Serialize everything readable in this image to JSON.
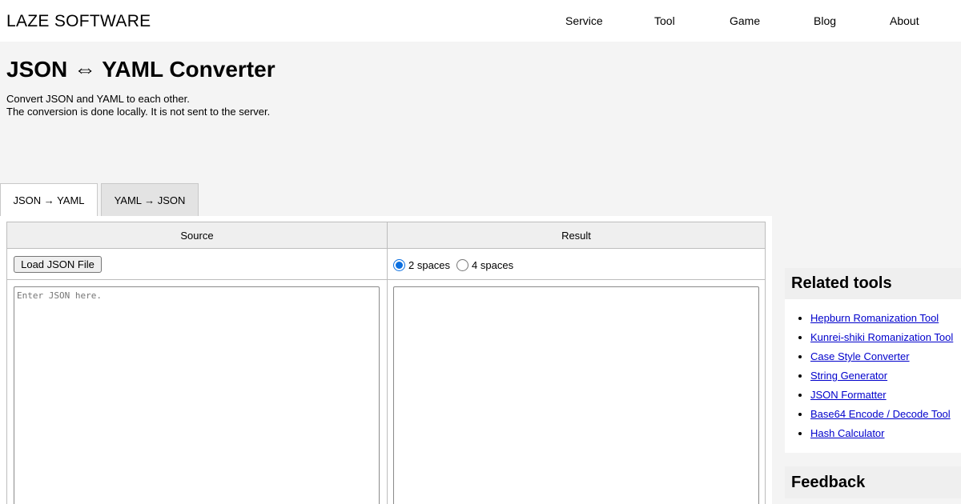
{
  "header": {
    "logo": "LAZE SOFTWARE",
    "nav": [
      "Service",
      "Tool",
      "Game",
      "Blog",
      "About"
    ]
  },
  "page": {
    "title": "JSON ⇔ YAML Converter",
    "description_line1": "Convert JSON and YAML to each other.",
    "description_line2": "The conversion is done locally. It is not sent to the server."
  },
  "tabs": [
    {
      "label": "JSON → YAML",
      "active": true
    },
    {
      "label": "YAML → JSON",
      "active": false
    }
  ],
  "converter": {
    "source_header": "Source",
    "result_header": "Result",
    "load_button": "Load JSON File",
    "indent_options": [
      {
        "label": "2 spaces",
        "checked": true
      },
      {
        "label": "4 spaces",
        "checked": false
      }
    ],
    "source_placeholder": "Enter JSON here.",
    "source_value": "",
    "result_value": ""
  },
  "sidebar": {
    "related_title": "Related tools",
    "related_tools": [
      "Hepburn Romanization Tool",
      "Kunrei-shiki Romanization Tool",
      "Case Style Converter",
      "String Generator",
      "JSON Formatter",
      "Base64 Encode / Decode Tool",
      "Hash Calculator"
    ],
    "feedback_title": "Feedback"
  },
  "colors": {
    "accent": "#0b6fe0",
    "link": "#0000cc",
    "background": "#f4f4f4"
  }
}
